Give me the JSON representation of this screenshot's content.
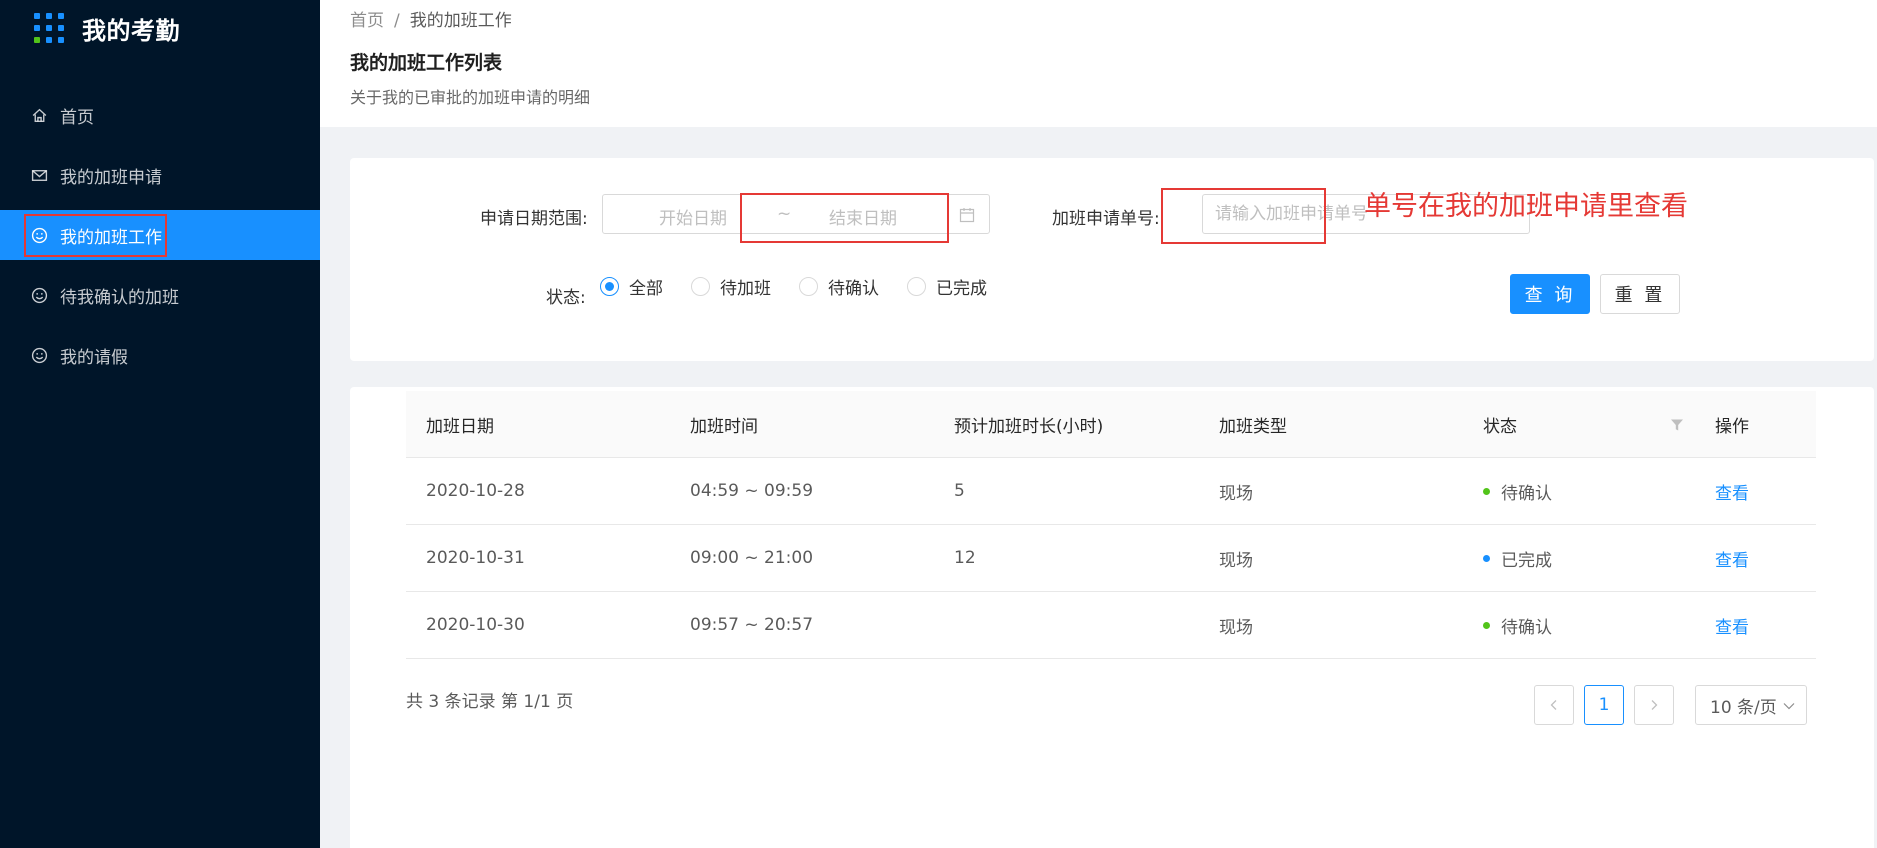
{
  "app": {
    "title": "我的考勤"
  },
  "sidebar": {
    "items": [
      {
        "label": "首页",
        "icon": "home-icon"
      },
      {
        "label": "我的加班申请",
        "icon": "mail-icon"
      },
      {
        "label": "我的加班工作",
        "icon": "smile-icon",
        "active": true
      },
      {
        "label": "待我确认的加班",
        "icon": "smile-icon"
      },
      {
        "label": "我的请假",
        "icon": "smile-icon"
      }
    ]
  },
  "header": {
    "breadcrumb": [
      "首页",
      "/",
      "我的加班工作"
    ],
    "title": "我的加班工作列表",
    "description": "关于我的已审批的加班申请的明细"
  },
  "search": {
    "date_range_label": "申请日期范围:",
    "start_placeholder": "开始日期",
    "tilde": "~",
    "end_placeholder": "结束日期",
    "apply_no_label": "加班申请单号:",
    "apply_no_placeholder": "请输入加班申请单号",
    "annotation": "单号在我的加班申请里查看",
    "status_label": "状态:",
    "status_options": [
      "全部",
      "待加班",
      "待确认",
      "已完成"
    ],
    "status_selected": "全部",
    "query_button": "查 询",
    "reset_button": "重 置"
  },
  "table": {
    "columns": [
      "加班日期",
      "加班时间",
      "预计加班时长(小时)",
      "加班类型",
      "状态",
      "操作"
    ],
    "rows": [
      {
        "date": "2020-10-28",
        "time": "04:59 ~ 09:59",
        "hours": "5",
        "type": "现场",
        "status": "待确认",
        "status_color": "#52c41a",
        "action": "查看"
      },
      {
        "date": "2020-10-31",
        "time": "09:00 ~ 21:00",
        "hours": "12",
        "type": "现场",
        "status": "已完成",
        "status_color": "#1890ff",
        "action": "查看"
      },
      {
        "date": "2020-10-30",
        "time": "09:57 ~ 20:57",
        "hours": "",
        "type": "现场",
        "status": "待确认",
        "status_color": "#52c41a",
        "action": "查看"
      }
    ]
  },
  "pagination": {
    "summary": "共 3 条记录 第 1/1 页",
    "current_page": "1",
    "page_size": "10 条/页"
  },
  "colors": {
    "primary": "#1890ff",
    "sidebar_bg": "#001529",
    "annotation": "#e53935"
  }
}
